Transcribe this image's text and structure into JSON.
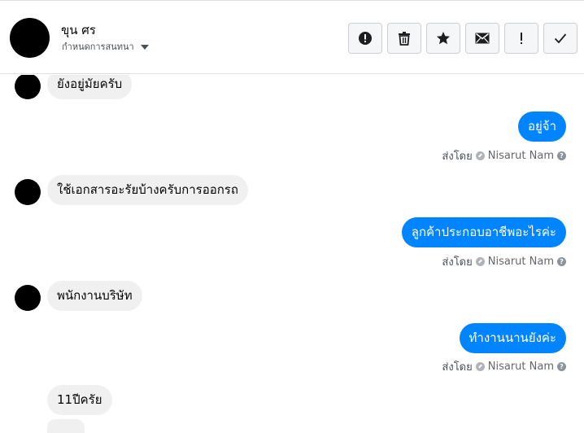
{
  "header": {
    "contact_name": "ขุน ศร",
    "subtitle": "กำหนดการสนทนา",
    "actions": [
      {
        "icon": "alert-circle-icon",
        "name": "mark-spam-button"
      },
      {
        "icon": "trash-icon",
        "name": "delete-button"
      },
      {
        "icon": "star-icon",
        "name": "star-button"
      },
      {
        "icon": "envelope-icon",
        "name": "mark-unread-button"
      },
      {
        "icon": "exclamation-icon",
        "name": "report-button"
      },
      {
        "icon": "checkmark-icon",
        "name": "mark-done-button"
      }
    ]
  },
  "messages": [
    {
      "direction": "in",
      "text": "ยังอยู่มัยครับ"
    },
    {
      "direction": "out",
      "text": "อยู่จ้า",
      "sent_label": "ส่งโดย",
      "sender": "Nisarut Nam"
    },
    {
      "direction": "in",
      "text": "ใช้เอกสารอะรัยบ้างครับการออกรถ"
    },
    {
      "direction": "out",
      "text": "ลูกค้าประกอบอาชีพอะไรค่ะ",
      "sent_label": "ส่งโดย",
      "sender": "Nisarut Nam"
    },
    {
      "direction": "in",
      "text": "พนักงานบริษัท"
    },
    {
      "direction": "out",
      "text": "ทำงานนานยังค่ะ",
      "sent_label": "ส่งโดย",
      "sender": "Nisarut Nam"
    },
    {
      "direction": "in",
      "text": "11ปีครัย"
    }
  ],
  "colors": {
    "outgoing_bubble": "#0084ff",
    "incoming_bubble": "#f0f0f0"
  }
}
